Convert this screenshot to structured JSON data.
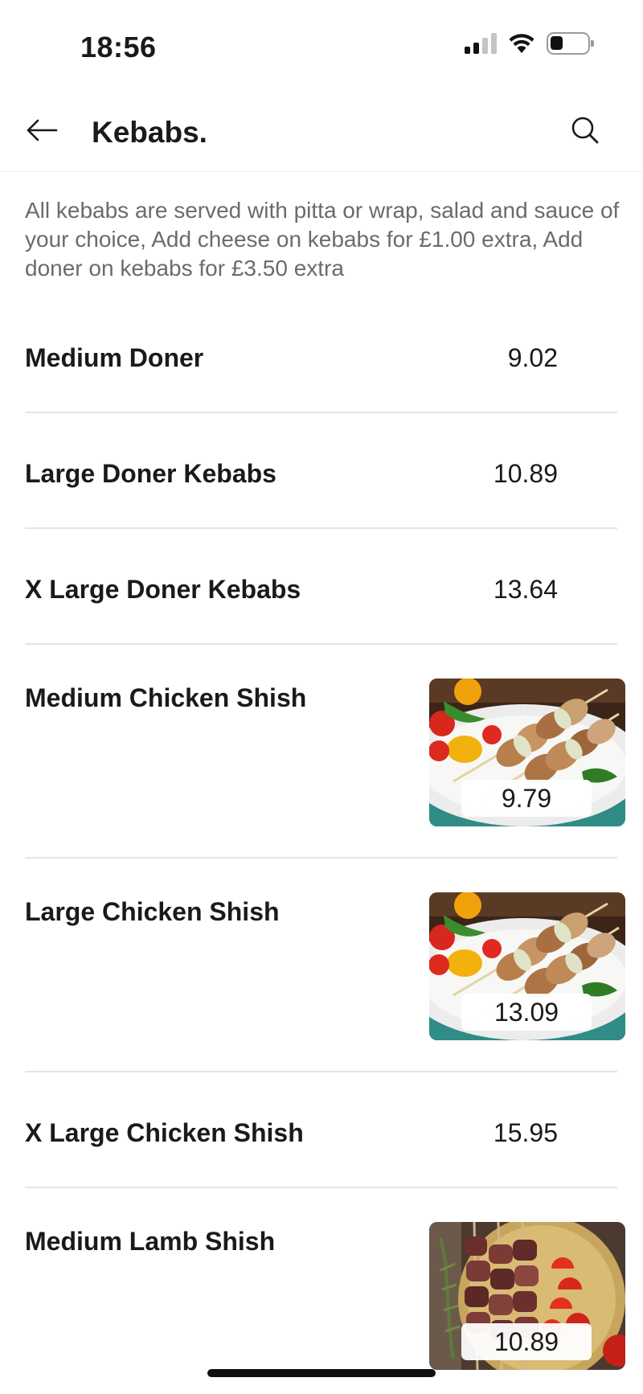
{
  "status_bar": {
    "time": "18:56",
    "icons": [
      "cellular-signal-icon",
      "wifi-icon",
      "battery-icon"
    ]
  },
  "header": {
    "back_icon": "arrow-left-icon",
    "title": "Kebabs.",
    "search_icon": "search-icon"
  },
  "description": "All kebabs are served with pitta or wrap, salad and sauce of your choice, Add cheese on kebabs for £1.00 extra, Add doner on kebabs for £3.50 extra",
  "menu": {
    "items": [
      {
        "name": "Medium Doner",
        "price": "9.02",
        "photo": "none"
      },
      {
        "name": "Large Doner Kebabs",
        "price": "10.89",
        "photo": "none"
      },
      {
        "name": "X Large Doner Kebabs",
        "price": "13.64",
        "photo": "none"
      },
      {
        "name": "Medium Chicken Shish",
        "price": "9.79",
        "photo": "chicken-shish-photo"
      },
      {
        "name": "Large Chicken Shish",
        "price": "13.09",
        "photo": "chicken-shish-photo"
      },
      {
        "name": "X Large Chicken Shish",
        "price": "15.95",
        "photo": "none"
      },
      {
        "name": "Medium Lamb Shish",
        "price": "10.89",
        "photo": "lamb-shish-photo"
      }
    ]
  },
  "colors": {
    "background": "#ffffff",
    "text_primary": "#1a1a1a",
    "text_secondary": "#6b6b6b",
    "divider": "#e4e4e4"
  }
}
